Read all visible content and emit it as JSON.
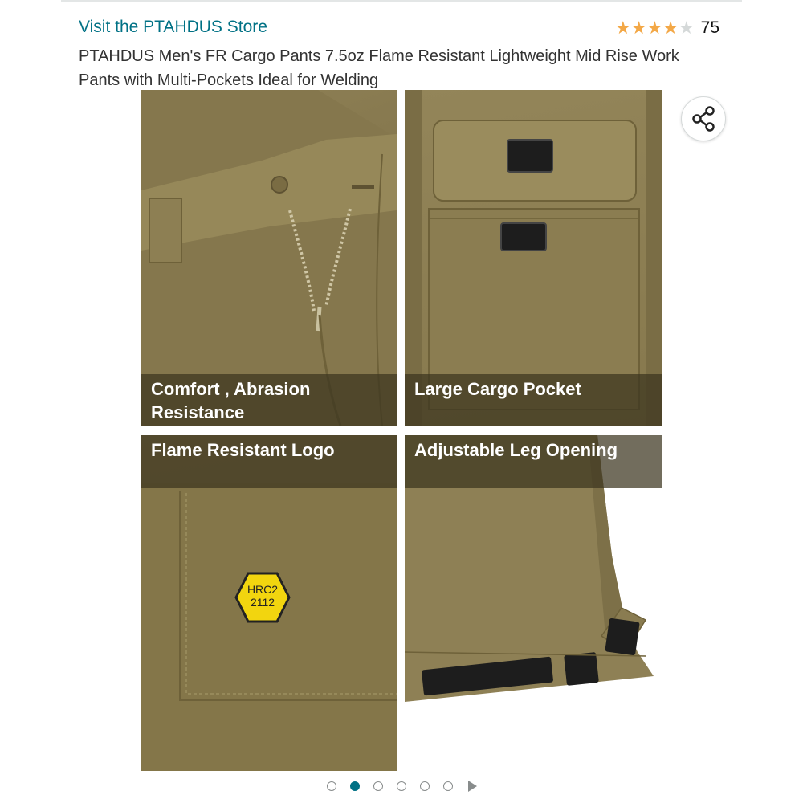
{
  "store": {
    "link_text": "Visit the PTAHDUS Store"
  },
  "rating": {
    "stars": 4,
    "max_stars": 5,
    "count": "75",
    "star_color": "#f3a847"
  },
  "product": {
    "title": "PTAHDUS Men's FR Cargo Pants 7.5oz Flame Resistant Lightweight Mid Rise Work Pants with Multi-Pockets Ideal for Welding"
  },
  "gallery": {
    "panels": [
      {
        "caption": "Comfort , Abrasion Resistance"
      },
      {
        "caption": "Large Cargo Pocket"
      },
      {
        "caption": "Flame Resistant Logo"
      },
      {
        "caption": "Adjustable Leg Opening"
      }
    ],
    "badge": {
      "line1": "HRC2",
      "line2": "2112"
    },
    "share_icon": "share-icon",
    "image_count": 7,
    "active_index": 1
  },
  "colors": {
    "link": "#007185",
    "fabric": "#8b7c52",
    "badge": "#f2d50f"
  }
}
